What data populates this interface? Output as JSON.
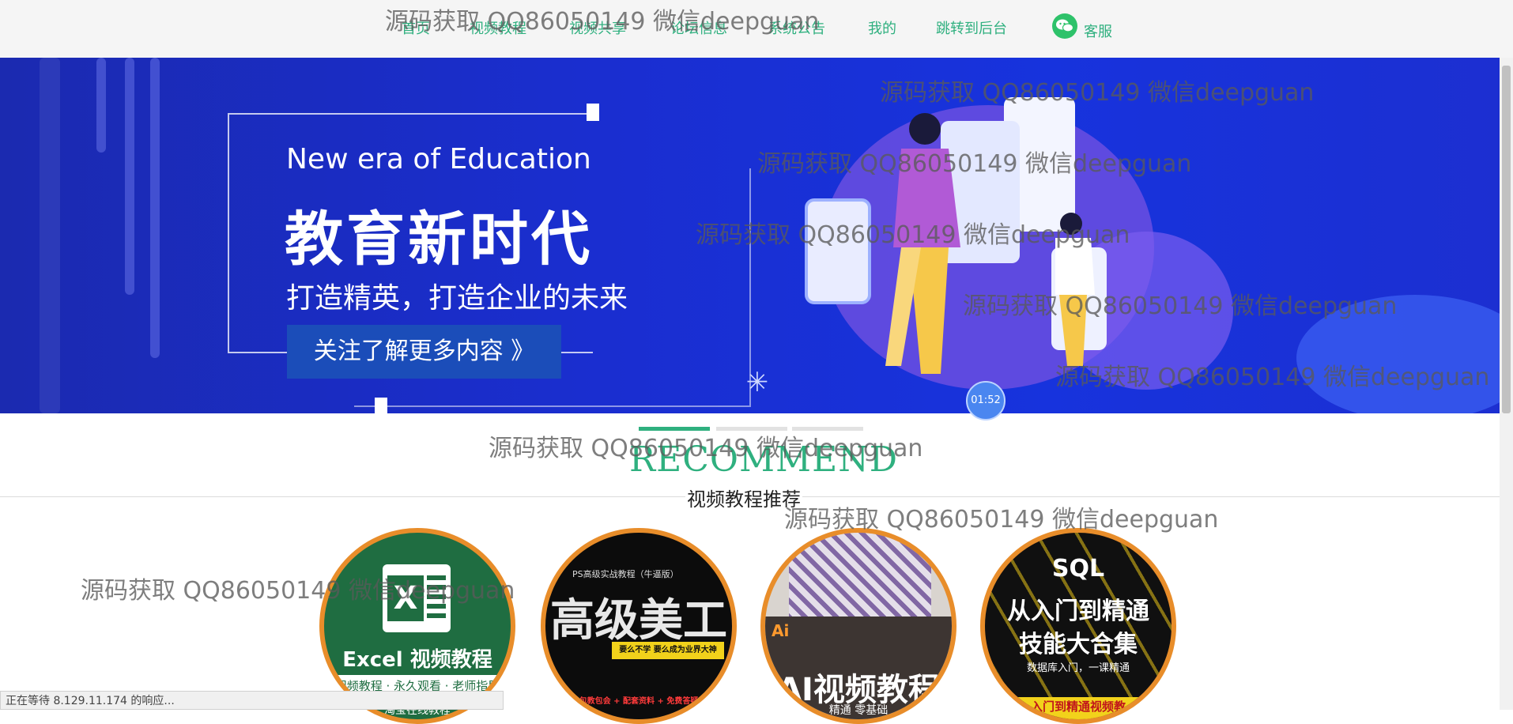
{
  "nav": {
    "items": [
      "首页",
      "视频教程",
      "视频共享",
      "论坛信息",
      "系统公告",
      "我的",
      "跳转到后台"
    ],
    "service_label": "客服"
  },
  "banner": {
    "en": "New era of Education",
    "cn": "教育新时代",
    "sub": "打造精英，打造企业的未来",
    "button": "关注了解更多内容 》",
    "timer": "01:52",
    "slides_total": 3,
    "active_slide": 1
  },
  "recommend": {
    "title": "RECOMMEND",
    "subtitle": "视频教程推荐"
  },
  "courses": [
    {
      "title": "Excel 视频教程",
      "line2": "视频教程 · 永久观看 · 老师指导",
      "line3": "淘宝在线教程"
    },
    {
      "top": "PS高级实战教程（牛逼版）",
      "title": "高级美工",
      "tag": "要么不学 要么成为业界大神",
      "line3": "包教包会 + 配套资料 + 免费答疑"
    },
    {
      "badge": "Ai",
      "title": "AI视频教程",
      "line3": "精通 零基础"
    },
    {
      "title": "SQL",
      "line2": "从入门到精通",
      "line3": "技能大合集",
      "tag": "数据库入门，一课精通",
      "foot": "入门到精通视频教"
    }
  ],
  "watermark": "源码获取 QQ86050149 微信deepguan",
  "status": "正在等待 8.129.11.174 的响应...",
  "colors": {
    "accent": "#2fb07f",
    "banner": "#1a2ed0",
    "ring": "#e88d2a"
  }
}
